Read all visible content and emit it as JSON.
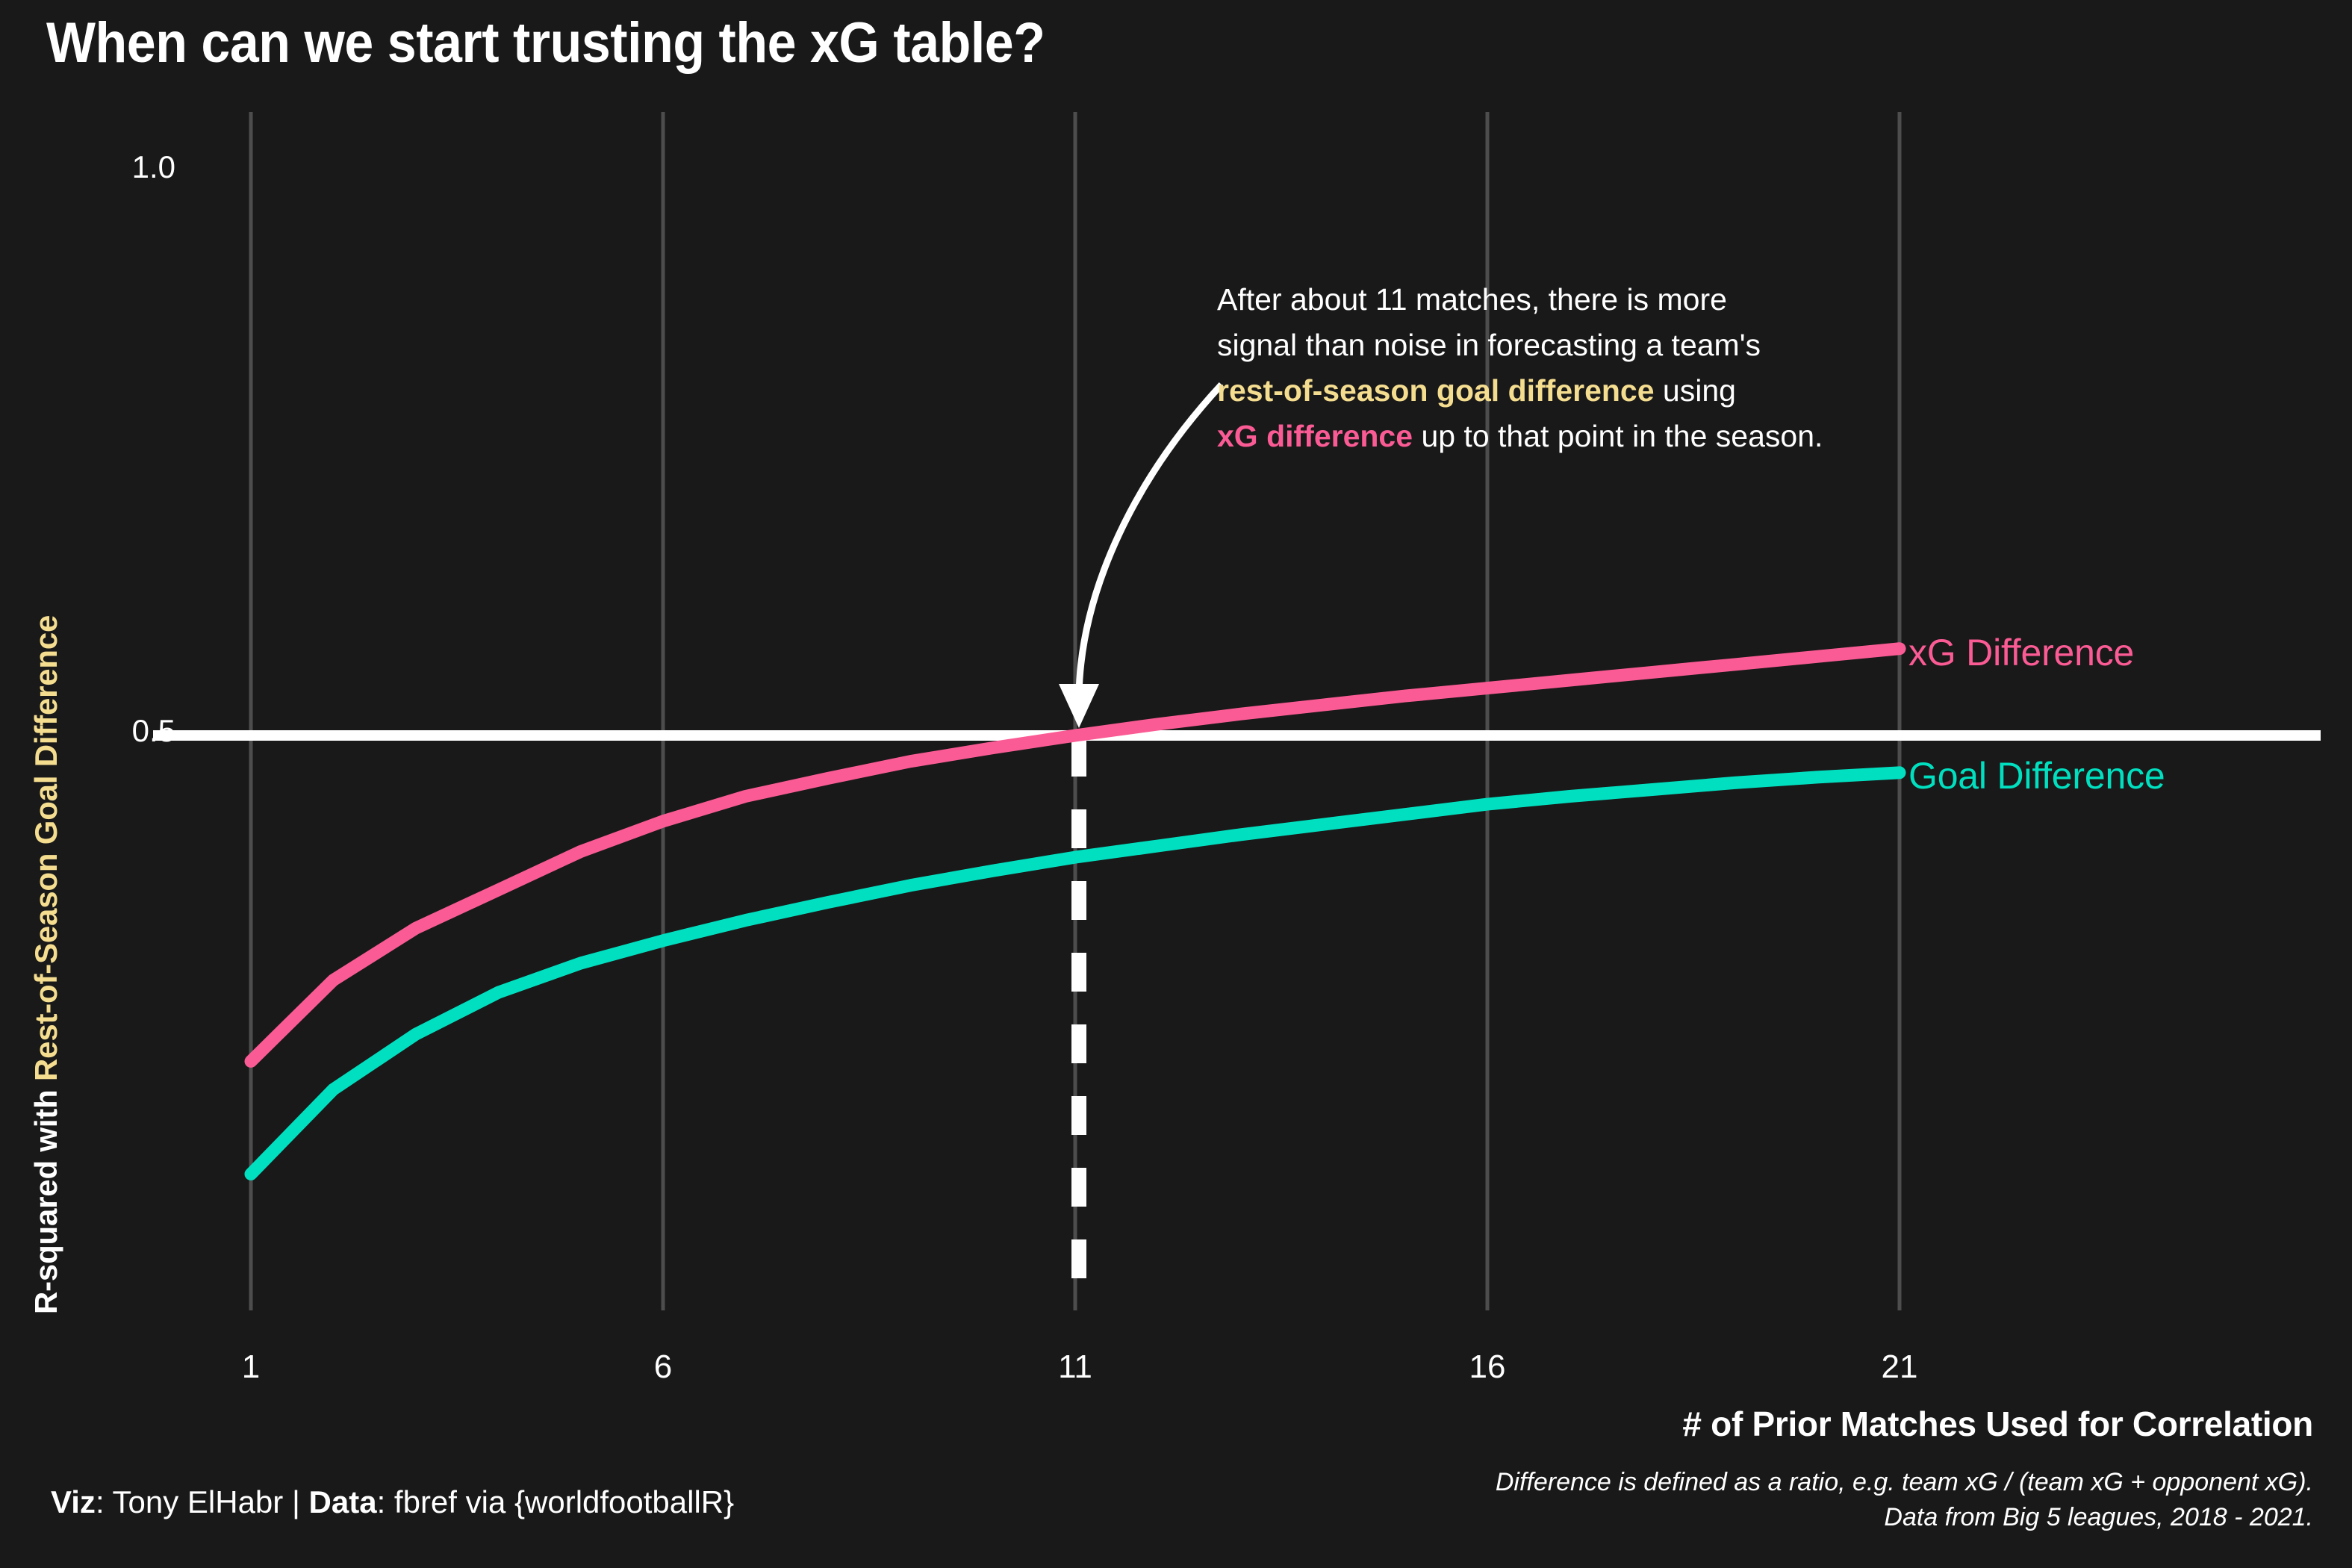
{
  "title": "When can we start trusting the xG table?",
  "axis": {
    "y_title_part1": "R-squared with ",
    "y_title_part2": "Rest-of-Season Goal Difference",
    "x_title": "# of Prior Matches Used for Correlation",
    "y_ticks": [
      "1.0",
      "0.5"
    ],
    "x_ticks": [
      "1",
      "6",
      "11",
      "16",
      "21"
    ]
  },
  "annotation": {
    "line1": "After about 11 matches, there is more",
    "line2": "signal than noise in forecasting a team's",
    "line3_gold": "rest-of-season goal difference",
    "line3_rest": " using",
    "line4_pink": "xG difference",
    "line4_rest": " up to that point in the season."
  },
  "series_labels": {
    "xg": "xG Difference",
    "gd": "Goal Difference"
  },
  "captions": {
    "credit_viz_label": "Viz",
    "credit_viz_value": ": Tony ElHabr | ",
    "credit_data_label": "Data",
    "credit_data_value": ": fbref via {worldfootballR}",
    "note_line1": "Difference is defined as a ratio, e.g. team xG / (team xG + opponent xG).",
    "note_line2": "Data from Big 5 leagues, 2018 - 2021."
  },
  "colors": {
    "background": "#191919",
    "xg_difference": "#fb5b94",
    "goal_difference": "#00e0c0",
    "gold": "#f5dd90",
    "white": "#ffffff",
    "gridline": "#4d4d4d"
  },
  "chart_data": {
    "type": "line",
    "title": "When can we start trusting the xG table?",
    "xlabel": "# of Prior Matches Used for Correlation",
    "ylabel": "R-squared with Rest-of-Season Goal Difference",
    "xlim": [
      1,
      21
    ],
    "ylim": [
      0.0,
      1.05
    ],
    "x_ticks": [
      1,
      6,
      11,
      16,
      21
    ],
    "y_ticks": [
      0.5,
      1.0
    ],
    "grid": "vertical",
    "legend": "inline-right-endpoints",
    "x": [
      1,
      2,
      3,
      4,
      5,
      6,
      7,
      8,
      9,
      10,
      11,
      12,
      13,
      14,
      15,
      16,
      17,
      18,
      19,
      20,
      21
    ],
    "series": [
      {
        "name": "xG Difference",
        "color": "#fb5b94",
        "values": [
          0.211,
          0.283,
          0.329,
          0.363,
          0.397,
          0.424,
          0.446,
          0.462,
          0.477,
          0.489,
          0.5,
          0.51,
          0.519,
          0.527,
          0.535,
          0.542,
          0.549,
          0.556,
          0.563,
          0.57,
          0.577
        ]
      },
      {
        "name": "Goal Difference",
        "color": "#00e0c0",
        "values": [
          0.111,
          0.186,
          0.235,
          0.272,
          0.298,
          0.318,
          0.336,
          0.352,
          0.367,
          0.38,
          0.392,
          0.402,
          0.412,
          0.421,
          0.43,
          0.439,
          0.446,
          0.452,
          0.458,
          0.463,
          0.467
        ]
      }
    ],
    "reference_lines": [
      {
        "orientation": "horizontal",
        "value": 0.5,
        "color": "#ffffff",
        "style": "solid"
      },
      {
        "orientation": "vertical",
        "value": 11,
        "color": "#ffffff",
        "style": "dashed",
        "y_from": 0.0,
        "y_to": 0.5
      }
    ],
    "annotations": [
      {
        "text": "After about 11 matches, there is more signal than noise in forecasting a team's rest-of-season goal difference using xG difference up to that point in the season.",
        "points_to": {
          "x": 11,
          "y": 0.5
        }
      }
    ]
  }
}
